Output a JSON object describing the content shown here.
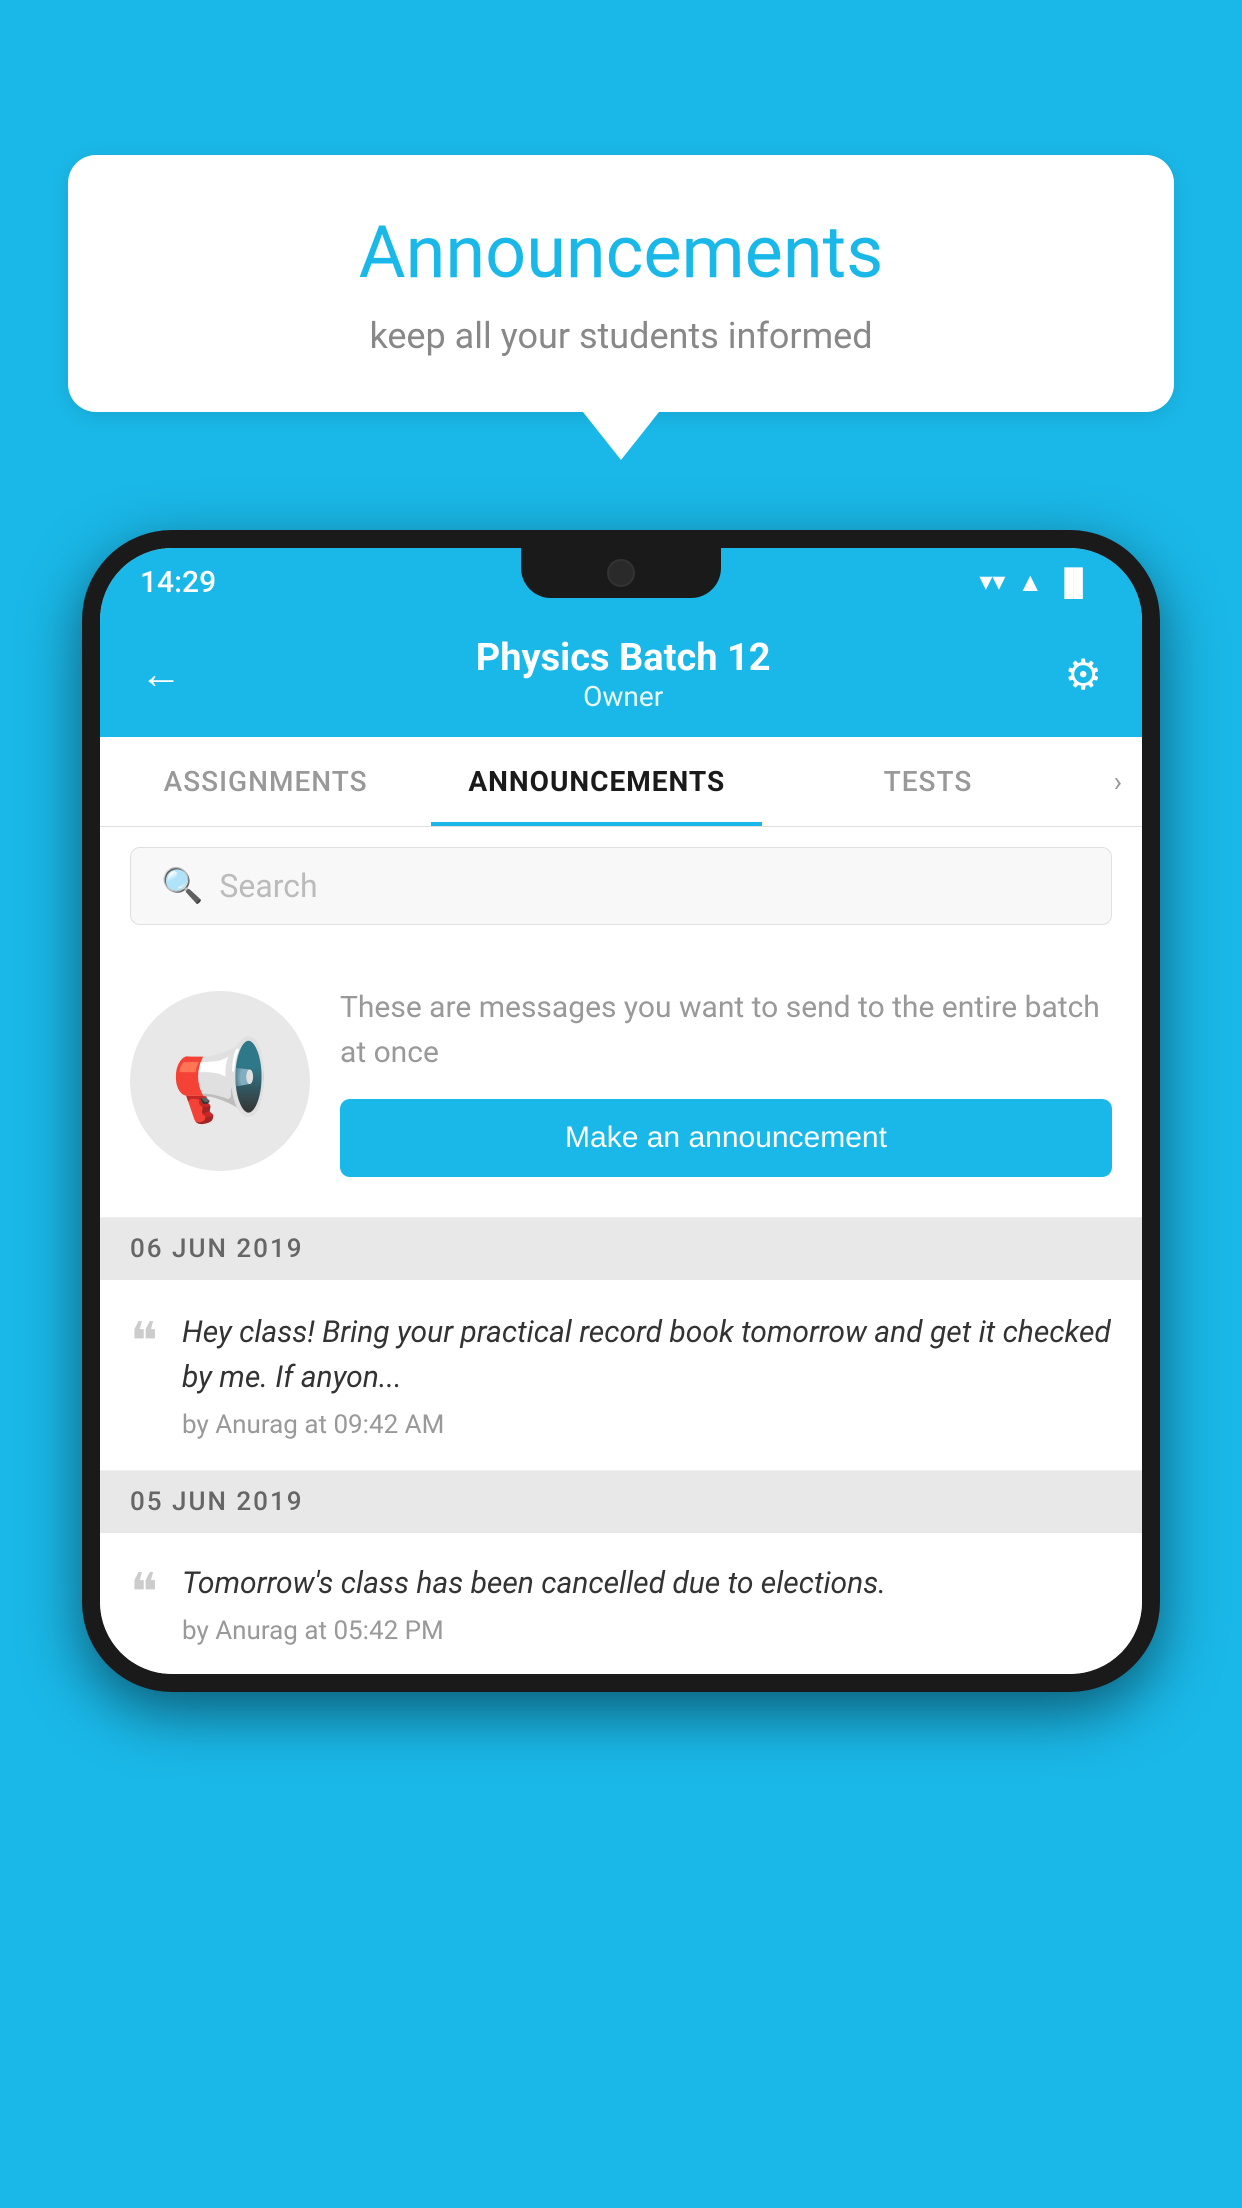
{
  "background_color": "#1ab8e8",
  "speech_bubble": {
    "title": "Announcements",
    "subtitle": "keep all your students informed"
  },
  "phone": {
    "status_bar": {
      "time": "14:29",
      "wifi": "▲",
      "signal": "◀",
      "battery": "▐"
    },
    "header": {
      "back_label": "←",
      "title": "Physics Batch 12",
      "subtitle": "Owner",
      "gear_label": "⚙"
    },
    "tabs": [
      {
        "label": "ASSIGNMENTS",
        "active": false
      },
      {
        "label": "ANNOUNCEMENTS",
        "active": true
      },
      {
        "label": "TESTS",
        "active": false
      }
    ],
    "search": {
      "placeholder": "Search"
    },
    "placeholder_section": {
      "description": "These are messages you want to send to the entire batch at once",
      "button_label": "Make an announcement"
    },
    "announcements": [
      {
        "date": "06  JUN  2019",
        "message": "Hey class! Bring your practical record book tomorrow and get it checked by me. If anyon...",
        "meta": "by Anurag at 09:42 AM"
      },
      {
        "date": "05  JUN  2019",
        "message": "Tomorrow's class has been cancelled due to elections.",
        "meta": "by Anurag at 05:42 PM"
      }
    ]
  }
}
